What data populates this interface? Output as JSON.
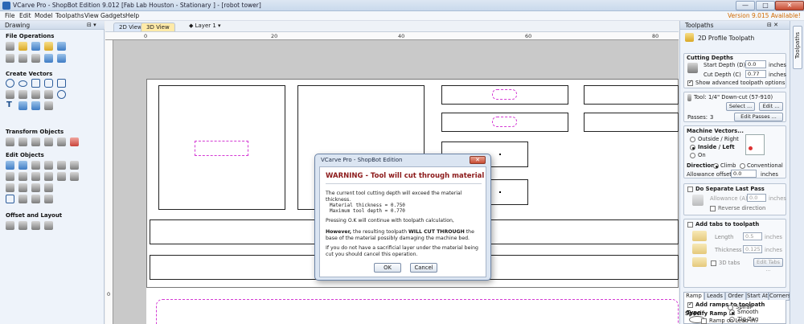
{
  "window": {
    "title": "VCarve Pro - ShopBot Edition 9.012 [Fab Lab Houston - Stationary ] - [robot tower]",
    "controls": [
      "—",
      "□",
      "✕"
    ]
  },
  "menubar": {
    "items": [
      "File",
      "Edit",
      "Model",
      "Toolpaths",
      "View",
      "Gadgets",
      "Help"
    ],
    "version_notice": "Version 9.015 Available!"
  },
  "left_panel": {
    "title": "Drawing",
    "sections": [
      "File Operations",
      "Create Vectors",
      "Transform Objects",
      "Edit Objects",
      "Offset and Layout"
    ]
  },
  "view": {
    "tab_2d": "2D View",
    "tab_3d": "3D View",
    "layer": "Layer 1"
  },
  "rulers": {
    "h_labels": [
      "0",
      "20",
      "40",
      "60",
      "80"
    ],
    "v_labels": [
      "0"
    ]
  },
  "right_panel": {
    "title": "Toolpaths",
    "vertical_tab": "Toolpaths",
    "header": "2D Profile Toolpath",
    "cutting_depths": {
      "title": "Cutting Depths",
      "start_label": "Start Depth (D)",
      "start_value": "0.0",
      "cut_label": "Cut Depth (C)",
      "cut_value": "0.77",
      "unit": "inches",
      "advanced": "Show advanced toolpath options"
    },
    "tool": {
      "label": "Tool:",
      "name": "1/4\" Down-cut (57-910)",
      "select": "Select ...",
      "edit": "Edit ...",
      "passes_label": "Passes:",
      "passes_value": "3",
      "edit_passes": "Edit Passes ..."
    },
    "machine_vectors": {
      "title": "Machine Vectors...",
      "outside": "Outside / Right",
      "inside": "Inside / Left",
      "on": "On",
      "direction_label": "Direction",
      "climb": "Climb",
      "conventional": "Conventional",
      "allowance_label": "Allowance offset",
      "allowance_value": "0.0",
      "unit": "inches"
    },
    "separate_last_pass": {
      "title": "Do Separate Last Pass",
      "allowance_label": "Allowance (A)",
      "allowance_value": "0.0",
      "unit": "inches",
      "reverse": "Reverse direction"
    },
    "tabs": {
      "title": "Add tabs to toolpath",
      "length_label": "Length",
      "length_value": "0.5",
      "thickness_label": "Thickness",
      "thickness_value": "0.125",
      "unit": "inches",
      "tabs_3d": "3D tabs",
      "edit_tabs": "Edit Tabs ..."
    },
    "bottom_tabs": [
      "Ramp",
      "Leads",
      "Order",
      "Start At",
      "Corners"
    ],
    "ramp": {
      "add_ramps": "Add ramps to toolpath",
      "type_label": "Type",
      "smooth": "Smooth",
      "zigzag": "Zig Zag",
      "spiral": "Spiral",
      "specify": "Specify Ramp ...",
      "ramp_on_lead": "Ramp on Lead In"
    }
  },
  "dialog": {
    "title": "VCarve Pro - ShopBot Edition",
    "warning": "WARNING - Tool will cut through material",
    "line1": "The current tool cutting depth will exceed the material thickness.",
    "thickness_line": "Material thickness = 0.750",
    "depth_line": "Maximum tool depth = 0.770",
    "line2": "Pressing O.K will continue with toolpath calculation,",
    "however": "However,",
    "line3_a": " the resulting toolpath ",
    "will_cut": "WILL CUT THROUGH",
    "line3_b": " the base of the material possibly damaging the machine bed.",
    "line4": "If you do not have a sacrificial layer under the material being cut you should cancel this operation.",
    "ok": "OK",
    "cancel": "Cancel"
  }
}
